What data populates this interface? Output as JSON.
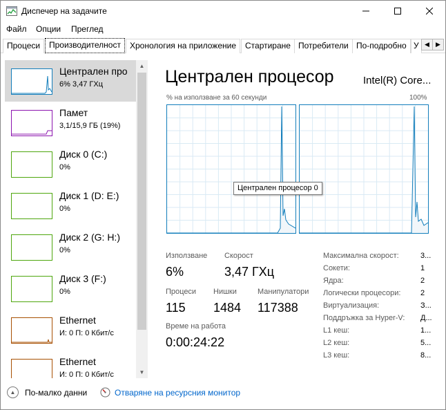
{
  "window": {
    "title": "Диспечер на задачите",
    "icon": "task-manager-icon"
  },
  "menu": [
    "Файл",
    "Опции",
    "Преглед"
  ],
  "tabs": [
    {
      "label": "Процеси",
      "active": false
    },
    {
      "label": "Производителност",
      "active": true
    },
    {
      "label": "Хронология на приложение",
      "active": false
    },
    {
      "label": "Стартиране",
      "active": false
    },
    {
      "label": "Потребители",
      "active": false
    },
    {
      "label": "По-подробно",
      "active": false
    },
    {
      "label": "У",
      "active": false
    }
  ],
  "sidebar": [
    {
      "name": "Централен про",
      "value": "6% 3,47 ГХц",
      "color": "#117dbb",
      "selected": true
    },
    {
      "name": "Памет",
      "value": "3,1/15,9 ГБ (19%)",
      "color": "#8b12ae",
      "selected": false
    },
    {
      "name": "Диск 0 (C:)",
      "value": "0%",
      "color": "#4da60c",
      "selected": false
    },
    {
      "name": "Диск 1 (D: E:)",
      "value": "0%",
      "color": "#4da60c",
      "selected": false
    },
    {
      "name": "Диск 2 (G: H:)",
      "value": "0%",
      "color": "#4da60c",
      "selected": false
    },
    {
      "name": "Диск 3 (F:)",
      "value": "0%",
      "color": "#4da60c",
      "selected": false
    },
    {
      "name": "Ethernet",
      "value": "И: 0 П: 0 Кбит/с",
      "color": "#a74f01",
      "selected": false
    },
    {
      "name": "Ethernet",
      "value": "И: 0 П: 0 Кбит/с",
      "color": "#a74f01",
      "selected": false
    }
  ],
  "main": {
    "title": "Централен процесор",
    "model": "Intel(R) Core...",
    "graph_caption": "% на използване за 60 секунди",
    "graph_max": "100%",
    "tooltip": "Централен процесор 0",
    "accent": "#117dbb",
    "grid_color": "#d9eaf4"
  },
  "stats": {
    "usage_label": "Използване",
    "usage_value": "6%",
    "speed_label": "Скорост",
    "speed_value": "3,47 ГХц",
    "processes_label": "Процеси",
    "processes_value": "115",
    "threads_label": "Нишки",
    "threads_value": "1484",
    "handles_label": "Манипулатори",
    "handles_value": "117388",
    "uptime_label": "Време на работа",
    "uptime_value": "0:00:24:22"
  },
  "details": [
    {
      "label": "Максимална скорост:",
      "value": "3..."
    },
    {
      "label": "Сокети:",
      "value": "1"
    },
    {
      "label": "Ядра:",
      "value": "2"
    },
    {
      "label": "Логически процесори:",
      "value": "2"
    },
    {
      "label": "Виртуализация:",
      "value": "З..."
    },
    {
      "label": "Поддръжка за Hyper-V:",
      "value": "Д..."
    },
    {
      "label": "L1 кеш:",
      "value": "1..."
    },
    {
      "label": "L2 кеш:",
      "value": "5..."
    },
    {
      "label": "L3 кеш:",
      "value": "8..."
    }
  ],
  "footer": {
    "fewer_details": "По-малко данни",
    "open_monitor": "Отваряне на ресурсния монитор"
  }
}
